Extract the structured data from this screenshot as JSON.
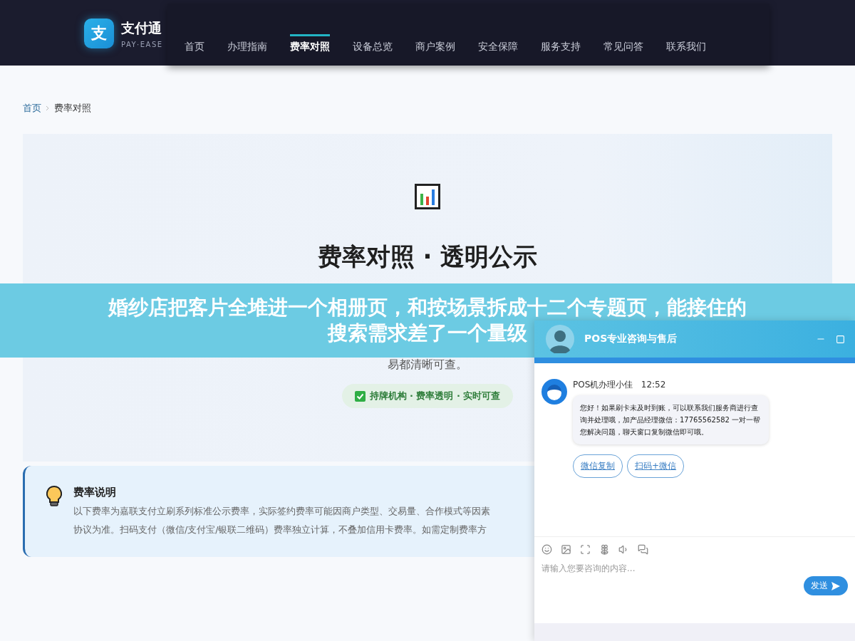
{
  "logo": {
    "mark": "支",
    "name": "支付通",
    "tagline": "PAY·EASE"
  },
  "nav": [
    {
      "label": "首页",
      "selected": false
    },
    {
      "label": "办理指南",
      "selected": false
    },
    {
      "label": "费率对照",
      "selected": true
    },
    {
      "label": "设备总览",
      "selected": false
    },
    {
      "label": "商户案例",
      "selected": false
    },
    {
      "label": "安全保障",
      "selected": false
    },
    {
      "label": "服务支持",
      "selected": false
    },
    {
      "label": "常见问答",
      "selected": false
    },
    {
      "label": "联系我们",
      "selected": false
    }
  ],
  "breadcrumb": [
    "首页",
    "费率对照"
  ],
  "hero": {
    "title": "费率对照 · 透明公示",
    "description": "易都清晰可查。",
    "badge": "持牌机构 · 费率透明 · 实时可查"
  },
  "notice": {
    "title": "费率说明",
    "lines": [
      "以下费率为嘉联支付立刷系列标准公示费率，实际签约费率可能因商户类型、交易量、合作模式等因素",
      "协议为准。扫码支付（微信/支付宝/银联二维码）费率独立计算，不叠加信用卡费率。如需定制费率方"
    ]
  },
  "overlay_caption": {
    "lines": [
      "婚纱店把客片全堆进一个相册页，和按场景拆成十二个专题页，能接住的",
      "搜索需求差了一个量级"
    ]
  },
  "chat": {
    "title": "POS专业咨询与售后",
    "messages": [
      {
        "sender": "POS机办理小佳",
        "time": "12:52",
        "text": "您好！如果刷卡未及时到账，可以联系我们服务商进行查询并处理哦，加产品经理微信：17765562582 一对一帮您解决问题，聊天窗口复制微信即可哦。",
        "actions": [
          "微信复制",
          "扫码+微信"
        ]
      }
    ],
    "input": {
      "placeholder": "请输入您要咨询的内容..."
    },
    "send": "发送"
  }
}
